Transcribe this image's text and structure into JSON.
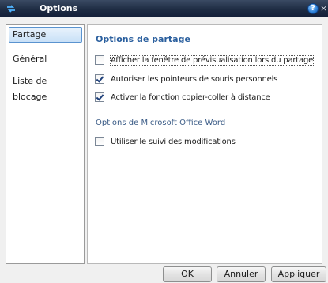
{
  "window": {
    "title": "Options",
    "help_label": "?",
    "close_label": "×"
  },
  "sidebar": {
    "items": [
      {
        "label": "Partage",
        "selected": true
      },
      {
        "label": "Général",
        "selected": false
      },
      {
        "label": "Liste de blocage",
        "selected": false
      }
    ]
  },
  "main": {
    "section_title": "Options de partage",
    "options": [
      {
        "label": "Afficher la fenêtre de prévisualisation lors du partage",
        "checked": false
      },
      {
        "label": "Autoriser les pointeurs de souris personnels",
        "checked": true
      },
      {
        "label": "Activer la fonction copier-coller à distance",
        "checked": true
      }
    ],
    "office_section_title": "Options de Microsoft Office Word",
    "office_options": [
      {
        "label": "Utiliser le suivi des modifications",
        "checked": false
      }
    ]
  },
  "buttons": {
    "ok_label": "OK",
    "cancel_label": "Annuler",
    "apply_label": "Appliquer"
  },
  "colors": {
    "titlebar": "#1f2d44",
    "accent_blue": "#2a5f9e",
    "selection_border": "#5a93cf"
  }
}
